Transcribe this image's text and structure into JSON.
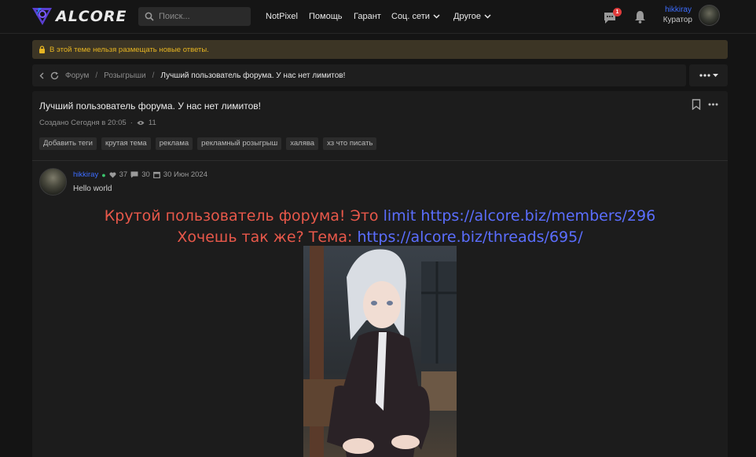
{
  "header": {
    "logo_text": "ALCORE",
    "search_placeholder": "Поиск...",
    "nav": [
      {
        "label": "NotPixel"
      },
      {
        "label": "Помощь"
      },
      {
        "label": "Гарант"
      },
      {
        "label": "Соц. сети"
      },
      {
        "label": "Другое"
      }
    ],
    "notifications_count": "1",
    "user": {
      "name": "hikkiray",
      "role": "Куратор"
    }
  },
  "notice": {
    "text": "В этой теме нельзя размещать новые ответы."
  },
  "breadcrumb": {
    "items": [
      "Форум",
      "Розыгрыши"
    ],
    "current": "Лучший пользователь форума. У нас нет лимитов!"
  },
  "thread": {
    "title": "Лучший пользователь форума. У нас нет лимитов!",
    "created": "Создано Сегодня в 20:05",
    "views": "11",
    "tags": [
      "Добавить теги",
      "крутая тема",
      "реклама",
      "рекламный розыгрыш",
      "халява",
      "хз что писать"
    ]
  },
  "post": {
    "author": "hikkiray",
    "likes": "37",
    "messages": "30",
    "date": "30 Июн 2024",
    "text": "Hello world",
    "line1_prefix": "Крутой пользователь форума! Это ",
    "line1_link_word": "limit",
    "line1_url": "https://alcore.biz/members/296",
    "line2_prefix": "Хочешь так же? Тема: ",
    "line2_url": "https://alcore.biz/threads/695/"
  },
  "colors": {
    "accent": "#3d6dff",
    "promo_red": "#e8584a",
    "link_blue": "#5b6eff",
    "notice_bg": "#3c3525",
    "notice_text": "#e6b422",
    "badge": "#e03b3b"
  },
  "icons": [
    "logo-mark-icon",
    "search-icon",
    "chevron-down-icon",
    "chat-icon",
    "bell-icon",
    "lock-icon",
    "back-chevron-icon",
    "refresh-icon",
    "ellipsis-icon",
    "bookmark-icon",
    "eye-icon",
    "heart-icon",
    "message-icon",
    "calendar-icon"
  ]
}
